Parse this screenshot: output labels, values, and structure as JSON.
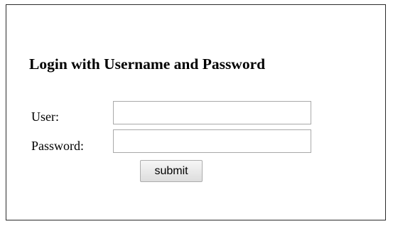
{
  "login": {
    "title": "Login with Username and Password",
    "user_label": "User:",
    "user_value": "",
    "password_label": "Password:",
    "password_value": "",
    "submit_label": "submit"
  }
}
